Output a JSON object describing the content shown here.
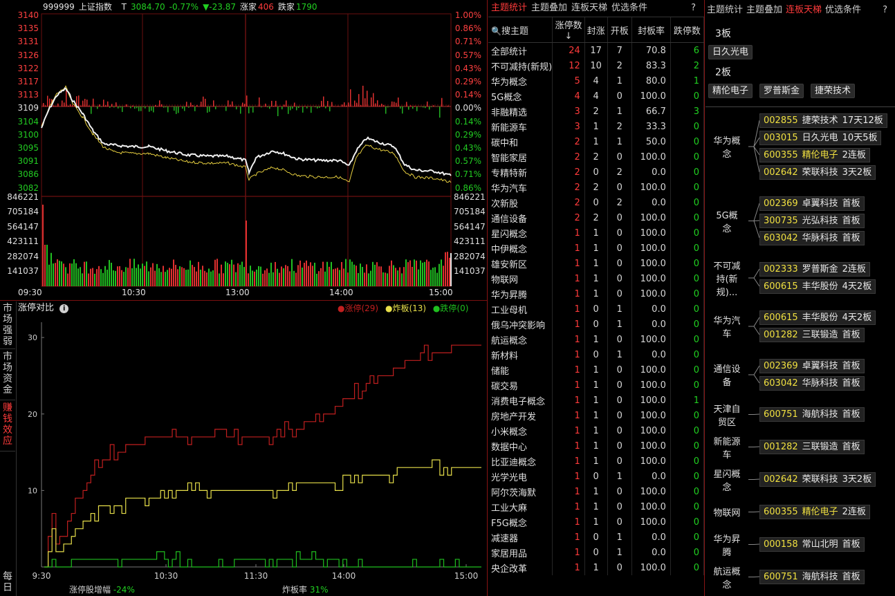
{
  "index_header": {
    "code": "999999",
    "name": "上证指数",
    "flag": "T",
    "price": "3084.70",
    "pct": "-0.77%",
    "change": "▼-23.87",
    "up_label": "涨家",
    "up_count": "406",
    "down_label": "跌家",
    "down_count": "1790"
  },
  "price_axis": {
    "left": [
      "3140",
      "3135",
      "3131",
      "3126",
      "3122",
      "3117",
      "3113",
      "3109",
      "3104",
      "3100",
      "3095",
      "3091",
      "3086",
      "3082"
    ],
    "right": [
      "1.00%",
      "0.86%",
      "0.71%",
      "0.57%",
      "0.43%",
      "0.29%",
      "0.14%",
      "0.00%",
      "0.14%",
      "0.29%",
      "0.43%",
      "0.57%",
      "0.71%",
      "0.86%"
    ]
  },
  "volume_axis": [
    "846221",
    "705184",
    "564147",
    "423111",
    "282074",
    "141037"
  ],
  "time_axis": [
    "09:30",
    "10:30",
    "13:00",
    "14:00",
    "15:00"
  ],
  "left_tabs": [
    "市场强弱",
    "市场资金",
    "赚钱效应",
    "每日"
  ],
  "limit_chart": {
    "title": "涨停对比",
    "info_icon": "info-icon",
    "legend": [
      {
        "label": "涨停(29)",
        "color": "#c21f1f"
      },
      {
        "label": "炸板(13)",
        "color": "#e8e04a"
      },
      {
        "label": "跌停(0)",
        "color": "#1fbf1f"
      }
    ],
    "y_ticks": [
      "30",
      "20",
      "10"
    ],
    "x_ticks": [
      "9:30",
      "10:30",
      "11:30",
      "14:00",
      "15:00"
    ],
    "footer_left_label": "涨停股增幅",
    "footer_left_value": "-24%",
    "footer_right_label": "炸板率",
    "footer_right_value": "31%"
  },
  "chart_data": {
    "type": "line",
    "title": "涨停对比",
    "x": [
      "9:30",
      "10:00",
      "10:30",
      "11:00",
      "11:30",
      "13:30",
      "14:00",
      "14:30",
      "15:00"
    ],
    "ylim": [
      0,
      32
    ],
    "y_ticks": [
      10,
      20,
      30
    ],
    "series": [
      {
        "name": "涨停",
        "values": [
          0,
          14,
          17,
          17,
          17,
          19,
          24,
          28,
          29
        ],
        "color": "#c21f1f"
      },
      {
        "name": "炸板",
        "values": [
          0,
          8,
          9,
          10,
          10,
          11,
          12,
          13,
          13
        ],
        "color": "#e8e04a"
      },
      {
        "name": "跌停",
        "values": [
          0,
          1,
          1,
          0,
          1,
          1,
          0,
          0,
          0
        ],
        "color": "#1fbf1f"
      }
    ]
  },
  "middle": {
    "tabs": [
      "主题统计",
      "主题叠加",
      "连板天梯",
      "优选条件",
      "?"
    ],
    "active_tab": 0,
    "columns": [
      "搜主题",
      "涨停数↓",
      "封涨",
      "开板",
      "封板率",
      "跌停数"
    ],
    "rows": [
      [
        "全部统计",
        "24",
        "17",
        "7",
        "70.8",
        "6"
      ],
      [
        "不可减持(新规)",
        "12",
        "10",
        "2",
        "83.3",
        "2"
      ],
      [
        "华为概念",
        "5",
        "4",
        "1",
        "80.0",
        "1"
      ],
      [
        "5G概念",
        "4",
        "4",
        "0",
        "100.0",
        "0"
      ],
      [
        "非融精选",
        "3",
        "2",
        "1",
        "66.7",
        "3"
      ],
      [
        "新能源车",
        "3",
        "1",
        "2",
        "33.3",
        "0"
      ],
      [
        "碳中和",
        "2",
        "1",
        "1",
        "50.0",
        "0"
      ],
      [
        "智能家居",
        "2",
        "2",
        "0",
        "100.0",
        "0"
      ],
      [
        "专精特新",
        "2",
        "0",
        "2",
        "0.0",
        "0"
      ],
      [
        "华为汽车",
        "2",
        "2",
        "0",
        "100.0",
        "0"
      ],
      [
        "次新股",
        "2",
        "0",
        "2",
        "0.0",
        "0"
      ],
      [
        "通信设备",
        "2",
        "2",
        "0",
        "100.0",
        "0"
      ],
      [
        "星闪概念",
        "1",
        "1",
        "0",
        "100.0",
        "0"
      ],
      [
        "中伊概念",
        "1",
        "1",
        "0",
        "100.0",
        "0"
      ],
      [
        "雄安新区",
        "1",
        "1",
        "0",
        "100.0",
        "0"
      ],
      [
        "物联网",
        "1",
        "1",
        "0",
        "100.0",
        "0"
      ],
      [
        "华为昇腾",
        "1",
        "1",
        "0",
        "100.0",
        "0"
      ],
      [
        "工业母机",
        "1",
        "0",
        "1",
        "0.0",
        "0"
      ],
      [
        "俄乌冲突影响",
        "1",
        "0",
        "1",
        "0.0",
        "0"
      ],
      [
        "航运概念",
        "1",
        "1",
        "0",
        "100.0",
        "0"
      ],
      [
        "新材料",
        "1",
        "0",
        "1",
        "0.0",
        "0"
      ],
      [
        "储能",
        "1",
        "1",
        "0",
        "100.0",
        "0"
      ],
      [
        "碳交易",
        "1",
        "1",
        "0",
        "100.0",
        "0"
      ],
      [
        "消费电子概念",
        "1",
        "1",
        "0",
        "100.0",
        "1"
      ],
      [
        "房地产开发",
        "1",
        "1",
        "0",
        "100.0",
        "0"
      ],
      [
        "小米概念",
        "1",
        "1",
        "0",
        "100.0",
        "0"
      ],
      [
        "数据中心",
        "1",
        "1",
        "0",
        "100.0",
        "0"
      ],
      [
        "比亚迪概念",
        "1",
        "1",
        "0",
        "100.0",
        "0"
      ],
      [
        "光学光电",
        "1",
        "0",
        "1",
        "0.0",
        "0"
      ],
      [
        "阿尔茨海默",
        "1",
        "1",
        "0",
        "100.0",
        "0"
      ],
      [
        "工业大麻",
        "1",
        "1",
        "0",
        "100.0",
        "0"
      ],
      [
        "F5G概念",
        "1",
        "1",
        "0",
        "100.0",
        "0"
      ],
      [
        "减速器",
        "1",
        "0",
        "1",
        "0.0",
        "0"
      ],
      [
        "家居用品",
        "1",
        "0",
        "1",
        "0.0",
        "0"
      ],
      [
        "央企改革",
        "1",
        "1",
        "0",
        "100.0",
        "0"
      ]
    ]
  },
  "right": {
    "tabs": [
      "主题统计",
      "主题叠加",
      "连板天梯",
      "优选条件",
      "?"
    ],
    "active_tab": 2,
    "ladder": [
      {
        "level": "3板",
        "stocks": [
          "日久光电"
        ]
      },
      {
        "level": "2板",
        "stocks": [
          "精伦电子",
          "罗普斯金",
          "捷荣技术"
        ]
      }
    ],
    "groups": [
      {
        "name": "华为概念",
        "items": [
          [
            "002855",
            "捷荣技术",
            "17天12板"
          ],
          [
            "003015",
            "日久光电",
            "10天5板"
          ],
          [
            "600355",
            "精伦电子",
            "2连板"
          ],
          [
            "002642",
            "荣联科技",
            "3天2板"
          ]
        ]
      },
      {
        "name": "5G概念",
        "items": [
          [
            "002369",
            "卓翼科技",
            "首板"
          ],
          [
            "300735",
            "光弘科技",
            "首板"
          ],
          [
            "603042",
            "华脉科技",
            "首板"
          ]
        ]
      },
      {
        "name": "不可减持(新规)...",
        "items": [
          [
            "002333",
            "罗普斯金",
            "2连板"
          ],
          [
            "600615",
            "丰华股份",
            "4天2板"
          ]
        ]
      },
      {
        "name": "华为汽车",
        "items": [
          [
            "600615",
            "丰华股份",
            "4天2板"
          ],
          [
            "001282",
            "三联锻造",
            "首板"
          ]
        ]
      },
      {
        "name": "通信设备",
        "items": [
          [
            "002369",
            "卓翼科技",
            "首板"
          ],
          [
            "603042",
            "华脉科技",
            "首板"
          ]
        ]
      },
      {
        "name": "天津自贸区",
        "items": [
          [
            "600751",
            "海航科技",
            "首板"
          ]
        ]
      },
      {
        "name": "新能源车",
        "items": [
          [
            "001282",
            "三联锻造",
            "首板"
          ]
        ]
      },
      {
        "name": "星闪概念",
        "items": [
          [
            "002642",
            "荣联科技",
            "3天2板"
          ]
        ]
      },
      {
        "name": "物联网",
        "items": [
          [
            "600355",
            "精伦电子",
            "2连板"
          ]
        ]
      },
      {
        "name": "华为昇腾",
        "items": [
          [
            "000158",
            "常山北明",
            "首板"
          ]
        ]
      },
      {
        "name": "航运概念",
        "items": [
          [
            "600751",
            "海航科技",
            "首板"
          ]
        ]
      }
    ]
  }
}
